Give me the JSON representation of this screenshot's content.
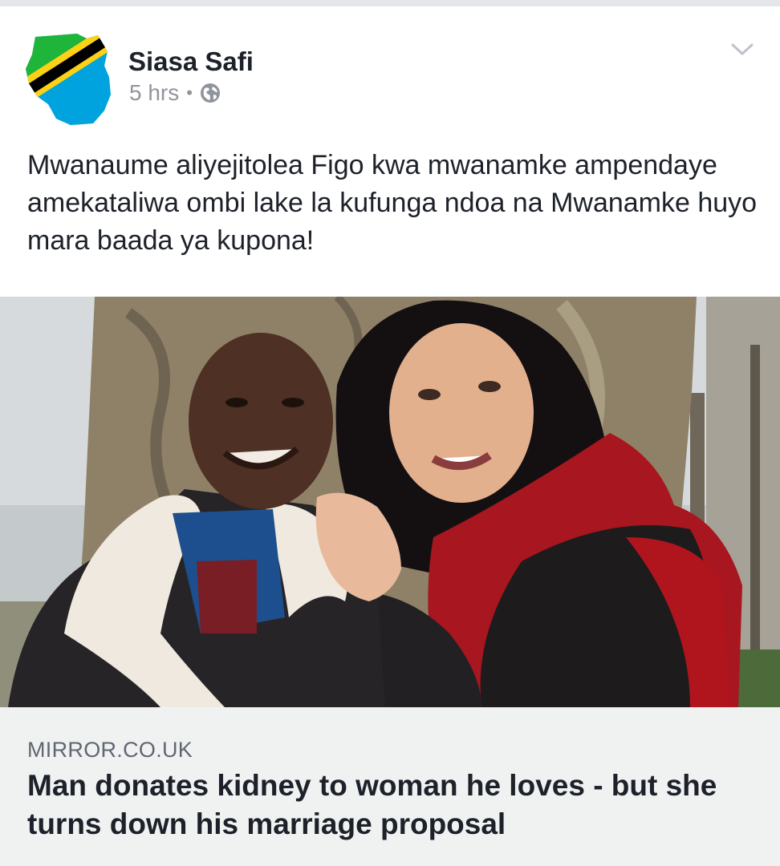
{
  "post": {
    "page_name": "Siasa Safi",
    "time": "5 hrs",
    "separator": "•",
    "privacy_icon": "globe-icon",
    "menu_icon": "chevron-down-icon",
    "text": "Mwanaume aliyejitolea Figo kwa mwanamke ampendaye amekataliwa ombi lake la kufunga ndoa na Mwanamke huyo mara baada ya kupona!"
  },
  "link": {
    "domain": "MIRROR.CO.UK",
    "headline": "Man donates kidney to woman he loves - but she turns down his marriage proposal"
  },
  "colors": {
    "text_primary": "#1d2129",
    "text_secondary": "#90949c",
    "caption_bg": "#f0f2f2",
    "flag_green": "#1eb53a",
    "flag_yellow": "#fcd116",
    "flag_black": "#000000",
    "flag_blue": "#00a3dd"
  }
}
